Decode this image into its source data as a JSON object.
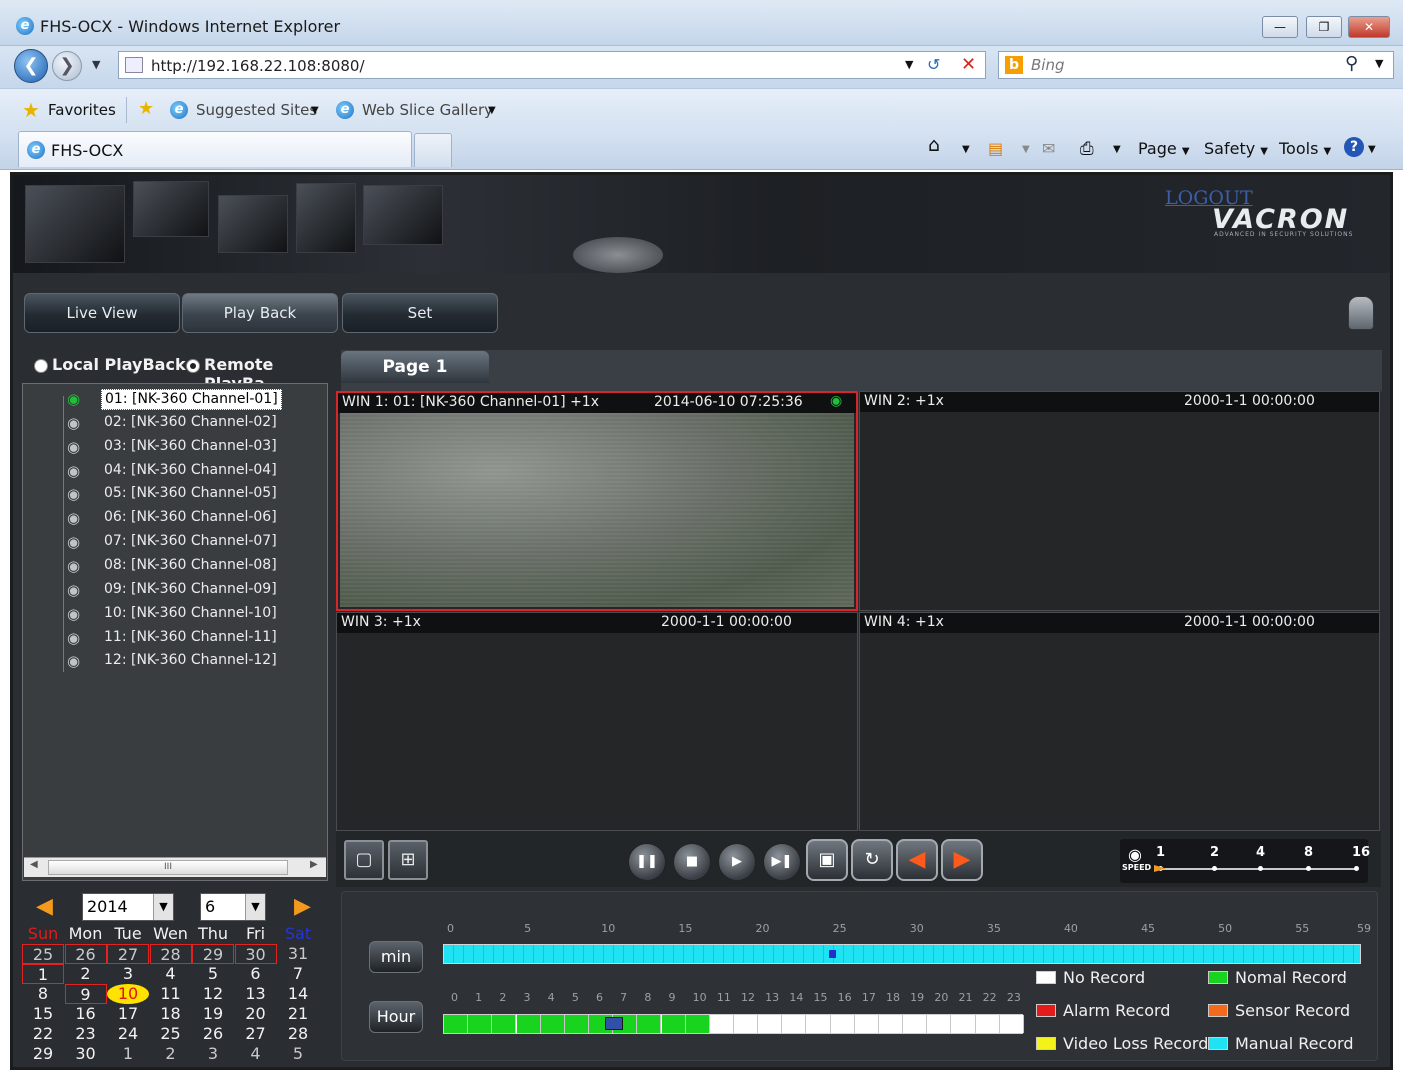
{
  "browser": {
    "window_title": "FHS-OCX - Windows Internet Explorer",
    "address": "http://192.168.22.108:8080/",
    "address_host": "192.168.22.108",
    "search_placeholder": "Bing",
    "favorites_label": "Favorites",
    "suggested_sites": "Suggested Sites",
    "web_slice_gallery": "Web Slice Gallery",
    "tab_title": "FHS-OCX",
    "commands": {
      "page": "Page",
      "safety": "Safety",
      "tools": "Tools"
    }
  },
  "app": {
    "logout": "LOGOUT",
    "brand": "VACRON",
    "brand_tagline": "ADVANCED IN SECURITY SOLUTIONS",
    "nav": {
      "live_view": "Live View",
      "play_back": "Play Back",
      "set": "Set",
      "active": "Play Back"
    },
    "playback_modes": {
      "local": "Local PlayBack",
      "remote": "Remote PlayBa",
      "selected": "remote"
    },
    "channels": [
      "01: [NK-360 Channel-01]",
      "02: [NK-360 Channel-02]",
      "03: [NK-360 Channel-03]",
      "04: [NK-360 Channel-04]",
      "05: [NK-360 Channel-05]",
      "06: [NK-360 Channel-06]",
      "07: [NK-360 Channel-07]",
      "08: [NK-360 Channel-08]",
      "09: [NK-360 Channel-09]",
      "10: [NK-360 Channel-10]",
      "11: [NK-360 Channel-11]",
      "12: [NK-360 Channel-12]"
    ],
    "selected_channel_index": 0,
    "scroll_thumb_mark": "III",
    "calendar": {
      "year": "2014",
      "month": "6",
      "weekdays": [
        "Sun",
        "Mon",
        "Tue",
        "Wen",
        "Thu",
        "Fri",
        "Sat"
      ],
      "weeks": [
        [
          "25",
          "26",
          "27",
          "28",
          "29",
          "30",
          "31"
        ],
        [
          "1",
          "2",
          "3",
          "4",
          "5",
          "6",
          "7"
        ],
        [
          "8",
          "9",
          "10",
          "11",
          "12",
          "13",
          "14"
        ],
        [
          "15",
          "16",
          "17",
          "18",
          "19",
          "20",
          "21"
        ],
        [
          "22",
          "23",
          "24",
          "25",
          "26",
          "27",
          "28"
        ],
        [
          "29",
          "30",
          "1",
          "2",
          "3",
          "4",
          "5"
        ]
      ],
      "today": "10"
    },
    "page_tab": "Page 1",
    "windows": [
      {
        "title": "WIN 1: 01: [NK-360 Channel-01]  +1x",
        "datetime": "2014-06-10 07:25:36",
        "selected": true
      },
      {
        "title": "WIN 2:  +1x",
        "datetime": "2000-1-1 00:00:00",
        "selected": false
      },
      {
        "title": "WIN 3:  +1x",
        "datetime": "2000-1-1 00:00:00",
        "selected": false
      },
      {
        "title": "WIN 4:  +1x",
        "datetime": "2000-1-1 00:00:00",
        "selected": false
      }
    ],
    "speed": {
      "label": "SPEED",
      "options": [
        "1",
        "2",
        "4",
        "8",
        "16"
      ],
      "selected": "1"
    },
    "timeline": {
      "min_label": "min",
      "hour_label": "Hour",
      "minute_ticks": [
        "0",
        "5",
        "10",
        "15",
        "20",
        "25",
        "30",
        "35",
        "40",
        "45",
        "50",
        "55",
        "59"
      ],
      "hour_ticks": [
        "0",
        "1",
        "2",
        "3",
        "4",
        "5",
        "6",
        "7",
        "8",
        "9",
        "10",
        "11",
        "12",
        "13",
        "14",
        "15",
        "16",
        "17",
        "18",
        "19",
        "20",
        "21",
        "22",
        "23"
      ],
      "minute_cursor": 25,
      "hour_cursor": 7,
      "hours_recorded_normal": 11
    },
    "legend": [
      {
        "label": "No Record",
        "color": "#ffffff"
      },
      {
        "label": "Nomal Record",
        "color": "#19d41f"
      },
      {
        "label": "Alarm Record",
        "color": "#e41b1b"
      },
      {
        "label": "Sensor Record",
        "color": "#f36a1d"
      },
      {
        "label": "Video Loss Record",
        "color": "#f3f31a"
      },
      {
        "label": "Manual Record",
        "color": "#1fe2f2"
      }
    ]
  }
}
